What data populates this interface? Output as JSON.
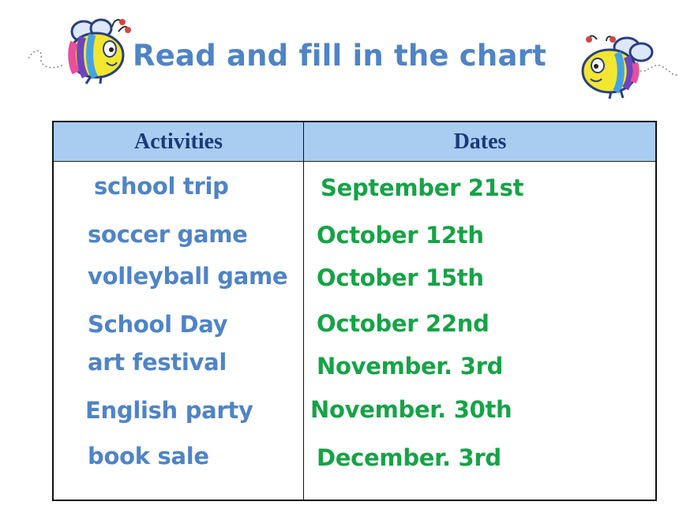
{
  "title": "Read and fill in the chart",
  "colors": {
    "title": "#4f84c6",
    "header_bg": "#a8cdf1",
    "header_text": "#1a3a78",
    "activity_text": "#4f84c6",
    "date_text": "#16a347"
  },
  "decorations": {
    "left_icon": "bee-icon",
    "right_icon": "bee-icon"
  },
  "table": {
    "headers": {
      "activities": "Activities",
      "dates": "Dates"
    },
    "rows": [
      {
        "activity": "school trip",
        "date": "September  21st"
      },
      {
        "activity": "soccer game",
        "date": "October 12th"
      },
      {
        "activity": "volleyball game",
        "date": "October 15th"
      },
      {
        "activity": "School Day",
        "date": "October 22nd"
      },
      {
        "activity": "art festival",
        "date": "November. 3rd"
      },
      {
        "activity": "English party",
        "date": "November. 30th"
      },
      {
        "activity": "book sale",
        "date": "December. 3rd"
      }
    ]
  }
}
